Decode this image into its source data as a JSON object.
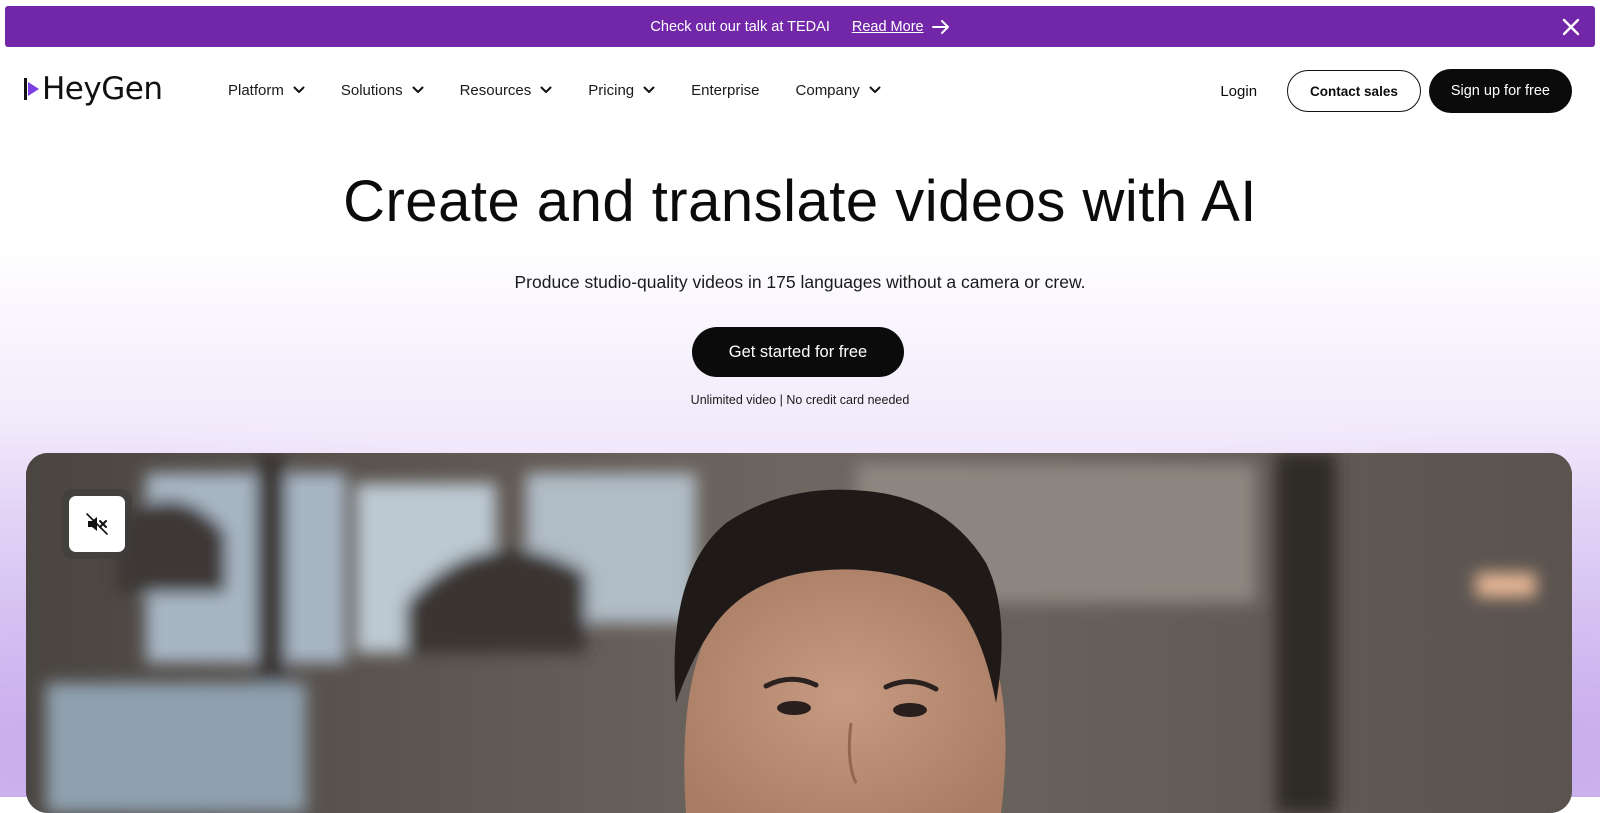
{
  "announcement": {
    "message": "Check out our talk at TEDAI",
    "link_label": "Read More",
    "arrow_icon": "arrow-right-icon",
    "close_icon": "close-icon",
    "background": "#7227a9"
  },
  "brand": {
    "logo_text": "HeyGen",
    "logo_accent": "#7b3fe4"
  },
  "nav": {
    "items": [
      {
        "label": "Platform",
        "has_dropdown": true
      },
      {
        "label": "Solutions",
        "has_dropdown": true
      },
      {
        "label": "Resources",
        "has_dropdown": true
      },
      {
        "label": "Pricing",
        "has_dropdown": true
      },
      {
        "label": "Enterprise",
        "has_dropdown": false
      },
      {
        "label": "Company",
        "has_dropdown": true
      }
    ],
    "login_label": "Login",
    "contact_label": "Contact sales",
    "signup_label": "Sign up for free"
  },
  "hero": {
    "title": "Create and translate videos with AI",
    "subtitle": "Produce studio-quality videos in 175 languages without a camera or crew.",
    "cta_label": "Get started for free",
    "note": "Unlimited video | No credit card needed"
  },
  "video": {
    "mute_icon": "speaker-muted-icon"
  }
}
